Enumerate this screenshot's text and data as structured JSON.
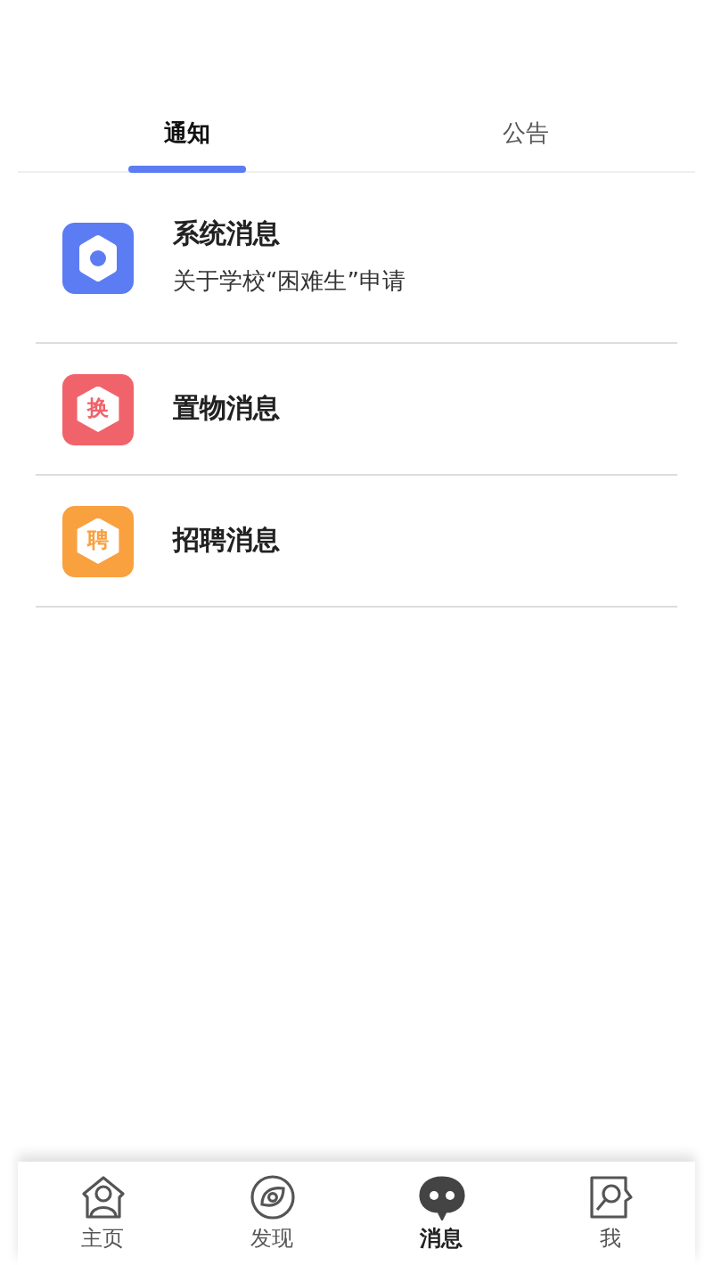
{
  "tabs": [
    {
      "label": "通知",
      "selected": true
    },
    {
      "label": "公告",
      "selected": false
    }
  ],
  "messages": [
    {
      "kind": "gear",
      "color": "#5b7cf2",
      "title": "系统消息",
      "subtitle": "关于学校“困难生”申请"
    },
    {
      "kind": "badge",
      "color": "#f0636a",
      "badge": "换",
      "title": "置物消息"
    },
    {
      "kind": "badge",
      "color": "#f9a03f",
      "badge": "聘",
      "title": "招聘消息"
    }
  ],
  "nav": [
    {
      "kind": "home",
      "label": "主页",
      "selected": false
    },
    {
      "kind": "discover",
      "label": "发现",
      "selected": false
    },
    {
      "kind": "chat",
      "label": "消息",
      "selected": true
    },
    {
      "kind": "me",
      "label": "我",
      "selected": false
    }
  ]
}
